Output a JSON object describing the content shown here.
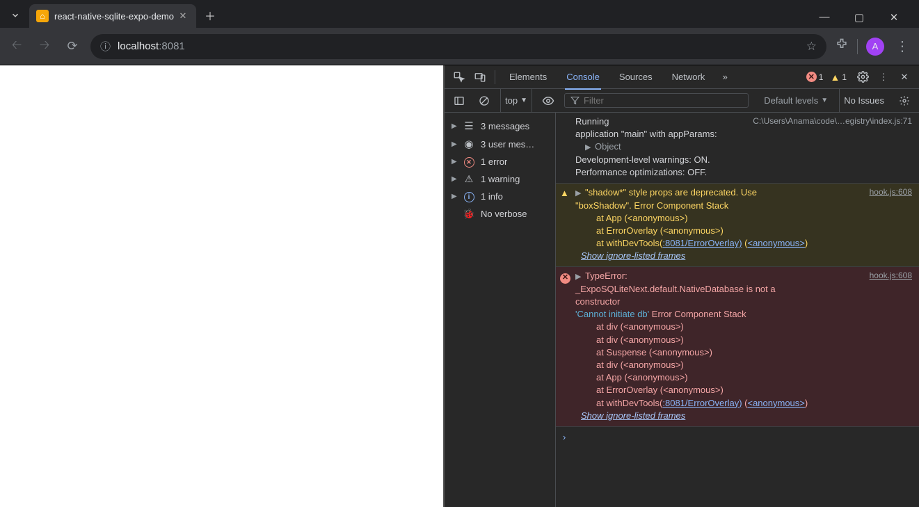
{
  "browser": {
    "tab_title": "react-native-sqlite-expo-demo",
    "url_host": "localhost",
    "url_port": ":8081",
    "avatar_initial": "A"
  },
  "devtools": {
    "tabs": {
      "elements": "Elements",
      "console": "Console",
      "sources": "Sources",
      "network": "Network"
    },
    "active_tab": "Console",
    "error_count": "1",
    "warning_count": "1",
    "context_label": "top",
    "filter_placeholder": "Filter",
    "levels_label": "Default levels",
    "issues_label": "No Issues"
  },
  "sidebar": {
    "messages": "3 messages",
    "user_messages": "3 user mes…",
    "errors": "1 error",
    "warnings": "1 warning",
    "info": "1 info",
    "no_verbose": "No verbose"
  },
  "console": {
    "log1": {
      "source": "C:\\Users\\Anama\\code\\…egistry\\index.js:71",
      "line1": "Running",
      "line2": "application \"main\" with appParams:",
      "object": "Object",
      "line4": "Development-level warnings: ON.",
      "line5": "Performance optimizations: OFF."
    },
    "warn1": {
      "source": "hook.js:608",
      "text_a": "\"shadow*\" style props are deprecated. Use",
      "text_b": "\"boxShadow\".",
      "stack_label": "Error Component Stack",
      "stack1": "at App (<anonymous>)",
      "stack2": "at ErrorOverlay (<anonymous>)",
      "stack3_pre": "at withDevTools(",
      "stack3_link1": ":8081/ErrorOverlay)",
      "stack3_mid": " (",
      "stack3_link2": "<anonymous>",
      "stack3_post": ")",
      "ignore": "Show ignore-listed frames"
    },
    "err1": {
      "source": "hook.js:608",
      "line1": "TypeError:",
      "line2": "_ExpoSQLiteNext.default.NativeDatabase is not a",
      "line3": "constructor",
      "literal": "'Cannot initiate db'",
      "stack_label": "Error Component Stack",
      "stack1": "at div (<anonymous>)",
      "stack2": "at div (<anonymous>)",
      "stack3": "at Suspense (<anonymous>)",
      "stack4": "at div (<anonymous>)",
      "stack5": "at App (<anonymous>)",
      "stack6": "at ErrorOverlay (<anonymous>)",
      "stack7_pre": "at withDevTools(",
      "stack7_link1": ":8081/ErrorOverlay)",
      "stack7_mid": " (",
      "stack7_link2": "<anonymous>",
      "stack7_post": ")",
      "ignore": "Show ignore-listed frames"
    }
  }
}
